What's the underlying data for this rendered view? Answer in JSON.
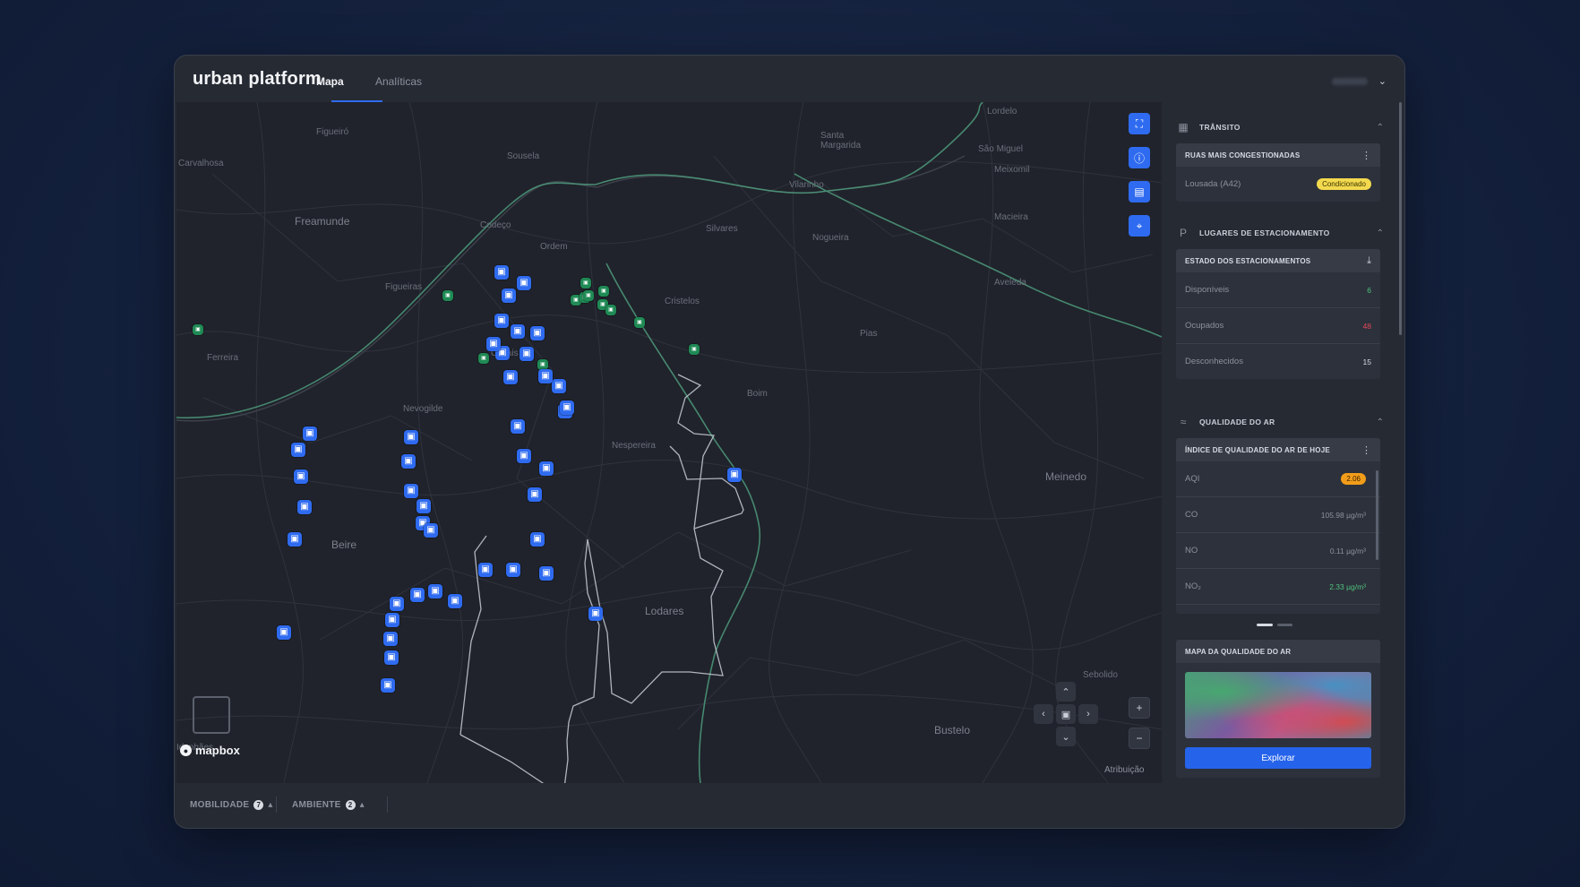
{
  "app": {
    "brand": "urban platform"
  },
  "tabs": [
    {
      "label": "Mapa",
      "active": true
    },
    {
      "label": "Analíticas",
      "active": false
    }
  ],
  "map": {
    "places": [
      "Lordelo",
      "Figueiró",
      "Carvalhosa",
      "Sousela",
      "Santa Margarida",
      "São Miguel",
      "Vilarinho",
      "Freamunde",
      "Codeço",
      "Silvares",
      "Ordem",
      "Nogueira",
      "Meixomil",
      "Macieira",
      "Figueiras",
      "Cristelos",
      "Aveleda",
      "Pias",
      "Ferreira",
      "Casais",
      "Nevogilde",
      "Boim",
      "Nespereira",
      "Meinedo",
      "Beire",
      "Lodares",
      "Bustelo",
      "Sebolido",
      "Idanhães"
    ],
    "brand_logo": "mapbox",
    "attribution": "Atribuição"
  },
  "bottombar": {
    "mobility_label": "MOBILIDADE",
    "mobility_count": "7",
    "environment_label": "AMBIENTE",
    "environment_count": "2"
  },
  "side": {
    "traffic": {
      "title": "TRÂNSITO",
      "card_title": "RUAS MAIS CONGESTIONADAS",
      "rows": [
        {
          "label": "Lousada (A42)",
          "status": "Condicionado"
        }
      ]
    },
    "parking": {
      "title": "LUGARES DE ESTACIONAMENTO",
      "card_title": "ESTADO DOS ESTACIONAMENTOS",
      "rows": [
        {
          "label": "Disponíveis",
          "value": "6"
        },
        {
          "label": "Ocupados",
          "value": "48"
        },
        {
          "label": "Desconhecidos",
          "value": "15"
        }
      ]
    },
    "air": {
      "title": "QUALIDADE DO AR",
      "card_title": "ÍNDICE DE QUALIDADE DO AR DE HOJE",
      "rows": [
        {
          "label": "AQI",
          "value": "2.06"
        },
        {
          "label": "CO",
          "value": "105.98 µg/m³"
        },
        {
          "label": "NO",
          "value": "0.11 µg/m³"
        },
        {
          "label": "NO₂",
          "value": "2.33 µg/m³"
        }
      ],
      "map_title": "MAPA DA QUALIDADE DO AR",
      "explore_label": "Explorar"
    }
  },
  "colors": {
    "accent": "#2f6bf0",
    "route": "#4e9a7c",
    "parking": "#1f8a55",
    "warning": "#f2d94e",
    "aqi": "#f29d1a"
  }
}
